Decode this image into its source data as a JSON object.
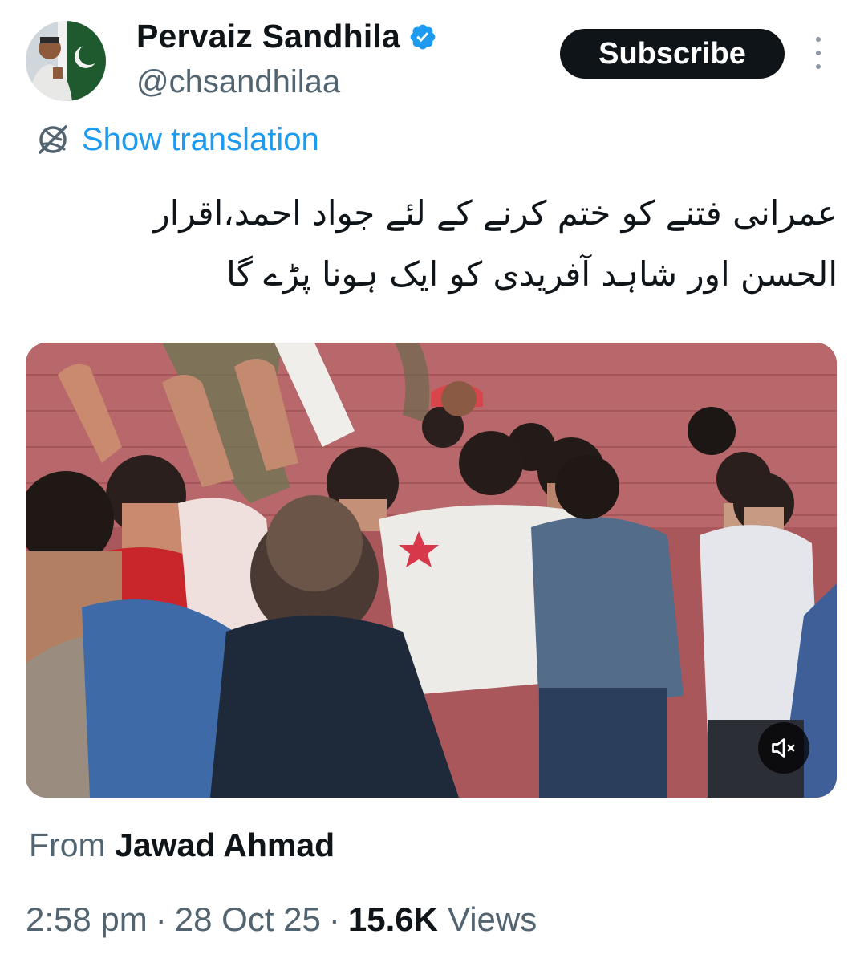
{
  "author": {
    "display_name": "Pervaiz Sandhila",
    "handle": "@chsandhilaa",
    "verified_color": "#1d9bf0"
  },
  "actions": {
    "subscribe_label": "Subscribe",
    "more_icon": "more-vertical-icon"
  },
  "translation": {
    "label": "Show translation",
    "icon": "translate-globe-icon"
  },
  "tweet": {
    "lines": [
      "عمرانی فتنے کو ختم کرنے کے لئے جواد احمد،اقرار",
      "الحسن اور شاہد آفریدی کو ایک ہونا پڑے گا"
    ]
  },
  "media": {
    "type": "video",
    "mute_icon": "muted-speaker-icon"
  },
  "source": {
    "prefix": "From",
    "name": "Jawad Ahmad"
  },
  "meta": {
    "time": "2:58 pm",
    "separator": "·",
    "date": "28 Oct 25",
    "views_count": "15.6K",
    "views_label": "Views"
  },
  "colors": {
    "link": "#1d9bf0",
    "secondary_text": "#536471",
    "primary_text": "#0f1419",
    "button_bg": "#0f1419"
  }
}
